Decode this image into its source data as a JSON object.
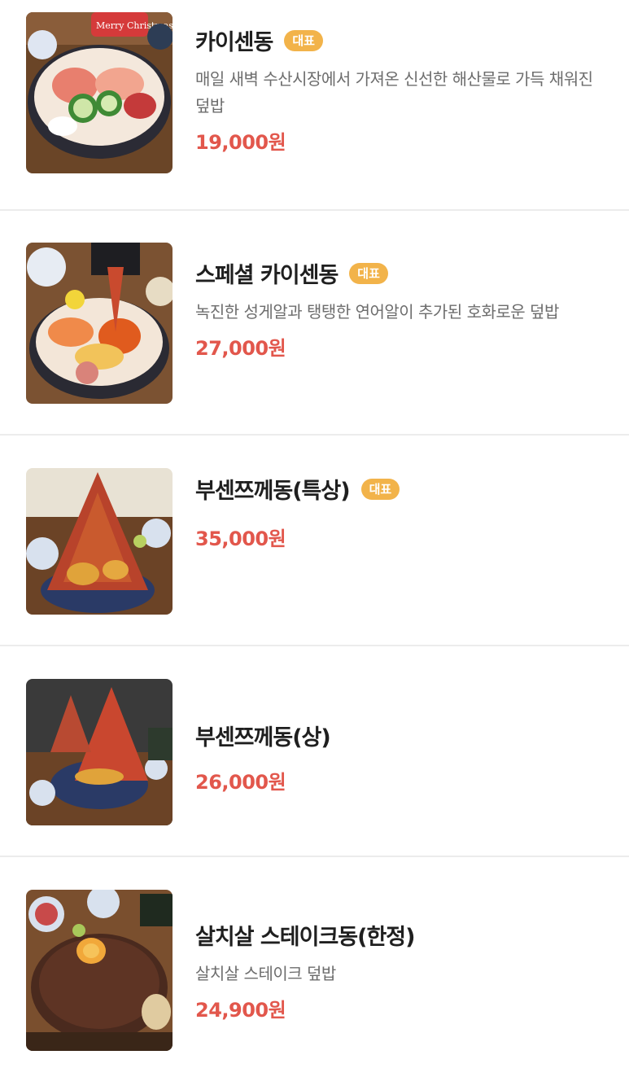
{
  "menu": {
    "items": [
      {
        "name": "카이센동",
        "badge": "대표",
        "description": "매일 새벽 수산시장에서 가져온 신선한 해산물로 가득 채워진 덮밥",
        "price": "19,000원",
        "photo_icon": "seafood-rice-bowl-photo",
        "sticker_text": "Merry Christmas"
      },
      {
        "name": "스페셜 카이센동",
        "badge": "대표",
        "description": "녹진한 성게알과 탱탱한 연어알이 추가된 호화로운 덮밥",
        "price": "27,000원",
        "photo_icon": "special-seafood-bowl-photo"
      },
      {
        "name": "부센쯔께동(특상)",
        "badge": "대표",
        "price": "35,000원",
        "photo_icon": "tower-seafood-bowl-photo"
      },
      {
        "name": "부센쯔께동(상)",
        "price": "26,000원",
        "photo_icon": "tower-seafood-bowl-photo"
      },
      {
        "name": "살치살 스테이크동(한정)",
        "description": "살치살 스테이크 덮밥",
        "price": "24,900원",
        "photo_icon": "steak-rice-bowl-photo"
      }
    ]
  },
  "colors": {
    "price": "#e2574c",
    "badge": "#f2b34a",
    "divider": "#ececec"
  }
}
